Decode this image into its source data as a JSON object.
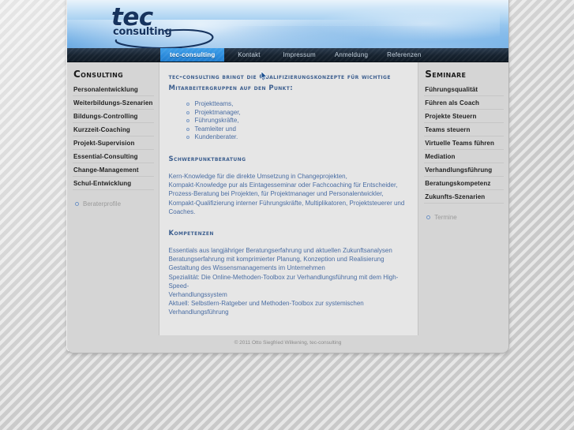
{
  "site": {
    "logo_primary": "tec",
    "logo_secondary": "consulting"
  },
  "nav": {
    "tabs": [
      {
        "label": "tec-consulting",
        "active": true
      },
      {
        "label": "Kontakt",
        "active": false
      },
      {
        "label": "Impressum",
        "active": false
      },
      {
        "label": "Anmeldung",
        "active": false
      },
      {
        "label": "Referenzen",
        "active": false
      }
    ]
  },
  "sidebar_left": {
    "title": "Consulting",
    "items": [
      {
        "label": "Personalentwicklung"
      },
      {
        "label": "Weiterbildungs-Szenarien"
      },
      {
        "label": "Bildungs-Controlling"
      },
      {
        "label": "Kurzzeit-Coaching"
      },
      {
        "label": "Projekt-Supervision"
      },
      {
        "label": "Essential-Consulting"
      },
      {
        "label": "Change-Management"
      },
      {
        "label": "Schul-Entwicklung"
      }
    ],
    "sub_items": [
      {
        "label": "Beraterprofile"
      }
    ]
  },
  "sidebar_right": {
    "title": "Seminare",
    "items": [
      {
        "label": "Führungsqualität"
      },
      {
        "label": "Führen als Coach"
      },
      {
        "label": "Projekte Steuern"
      },
      {
        "label": "Teams steuern"
      },
      {
        "label": "Virtuelle Teams führen"
      },
      {
        "label": "Mediation"
      },
      {
        "label": "Verhandlungsführung"
      },
      {
        "label": "Beratungskompetenz"
      },
      {
        "label": "Zukunfts-Szenarien"
      }
    ],
    "sub_items": [
      {
        "label": "Termine"
      }
    ]
  },
  "main": {
    "intro_line_1": "tec-consulting bringt die   Qualifizierungskonzepte für wichtige",
    "intro_line_2": "Mitarbeitergruppen auf den Punkt:",
    "target_groups": [
      "Projektteams,",
      "Projektmanager,",
      "Führungskräfte,",
      "Teamleiter und",
      "Kundenberater."
    ],
    "sections": [
      {
        "heading": "Schwerpunktberatung",
        "paragraphs": [
          "Kern-Knowledge für die direkte Umsetzung in Changeprojekten,",
          "Kompakt-Knowledge pur als Eintagesseminar oder Fachcoaching für Entscheider,",
          "Prozess-Beratung bei Projekten, für Projektmanager und Personalentwickler,",
          "Kompakt-Qualifizierung interner Führungskräfte, Multiplikatoren, Projektsteuerer und",
          "Coaches."
        ]
      },
      {
        "heading": "Kompetenzen",
        "paragraphs": [
          "Essentials aus langjähriger Beratungserfahrung und aktuellen Zukunftsanalysen",
          "Beratungserfahrung mit komprimierter Planung, Konzeption und Realisierung",
          "Gestaltung des Wissensmanagements im Unternehmen",
          "Spezialität: Die Online-Methoden-Toolbox zur Verhandlungsführung mit dem High-Speed-",
          "Verhandlungssystem",
          "Aktuell: Selbstlern-Ratgeber und Methoden-Toolbox zur systemischen",
          "Verhandlungsführung"
        ]
      }
    ]
  },
  "footer": {
    "copyright": "© 2011 Otto Siegfried Wilkening, tec-consulting"
  },
  "colors": {
    "accent_blue": "#2e8ddd",
    "text_blue": "#4a6da3",
    "heading_blue": "#3d5f8f",
    "nav_dark": "#16222f",
    "panel_bg": "#e6e6e6",
    "sidebar_bg": "#d5d5d5"
  }
}
